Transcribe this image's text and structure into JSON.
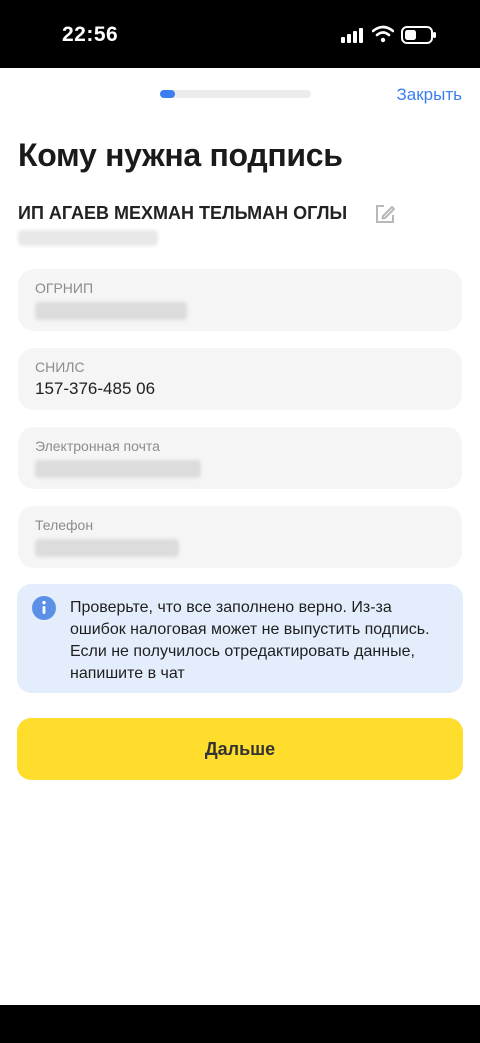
{
  "status_bar": {
    "time": "22:56"
  },
  "header": {
    "close_label": "Закрыть",
    "progress_fraction": 0.1
  },
  "page": {
    "title": "Кому нужна подпись",
    "owner_name": "ИП АГАЕВ МЕХМАН ТЕЛЬМАН ОГЛЫ"
  },
  "fields": {
    "ogrnip": {
      "label": "ОГРНИП"
    },
    "snils": {
      "label": "СНИЛС",
      "value": "157-376-485 06"
    },
    "email": {
      "label": "Электронная почта"
    },
    "phone": {
      "label": "Телефон"
    }
  },
  "info": {
    "text": "Проверьте, что все заполнено верно. Из-за ошибок налоговая может не выпустить подпись. Если не получилось отредактировать данные, напишите в чат"
  },
  "actions": {
    "next_label": "Дальше"
  },
  "colors": {
    "accent": "#3b7ef0",
    "button": "#ffdd2d",
    "info_bg": "#e3edfb",
    "field_bg": "#f5f5f5"
  },
  "icons": [
    "signal-icon",
    "wifi-icon",
    "battery-icon",
    "edit-icon",
    "info-icon"
  ]
}
